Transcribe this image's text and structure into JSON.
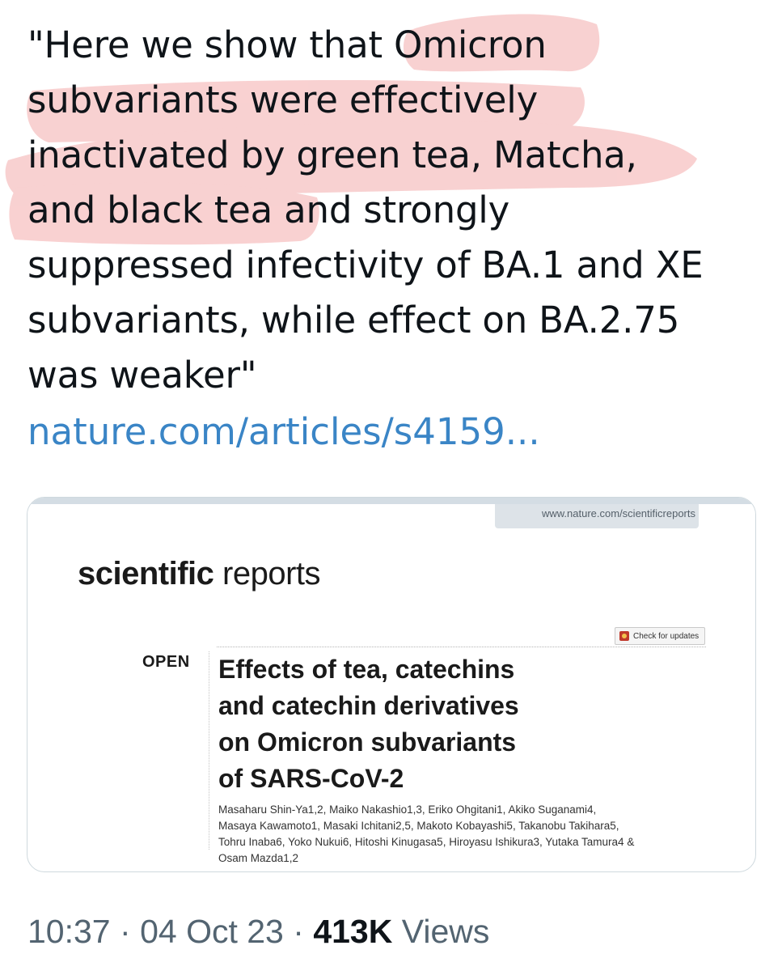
{
  "tweet": {
    "text_lines": [
      "\"Here we show that Omicron",
      "subvariants were effectively",
      "inactivated by green tea, Matcha,",
      "and black tea and strongly",
      "suppressed infectivity of BA.1 and XE",
      "subvariants, while effect on BA.2.75",
      "was weaker\""
    ],
    "link_text": "nature.com/articles/s4159...",
    "link_color": "#3a85c6",
    "highlight_color": "#f5a3a3"
  },
  "card": {
    "site_url": "www.nature.com/scientificreports",
    "journal_bold": "scientific",
    "journal_light": " reports",
    "check_updates_label": "Check for updates",
    "open_label": "OPEN",
    "title_lines": [
      "Effects of tea, catechins",
      "and catechin derivatives",
      "on Omicron subvariants",
      "of SARS-CoV-2"
    ],
    "author_lines": [
      "Masaharu Shin-Ya1,2, Maiko Nakashio1,3, Eriko Ohgitani1, Akiko Suganami4,",
      "Masaya Kawamoto1, Masaki Ichitani2,5, Makoto Kobayashi5, Takanobu Takihara5,",
      "Tohru Inaba6, Yoko Nukui6, Hitoshi Kinugasa5, Hiroyasu Ishikura3, Yutaka Tamura4 &",
      "Osam Mazda1,2"
    ]
  },
  "meta": {
    "time": "10:37",
    "separator": "·",
    "date": "04 Oct 23",
    "views_count": "413K",
    "views_label": "Views"
  }
}
